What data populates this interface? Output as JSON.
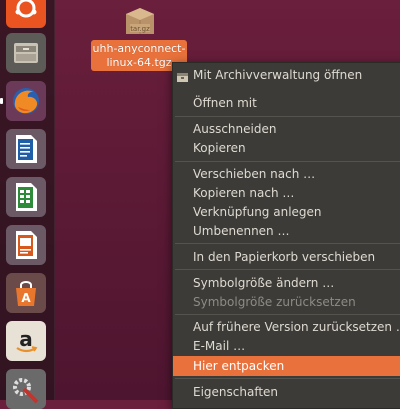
{
  "launcher": {
    "items": [
      {
        "name": "ubuntu-dash-icon"
      },
      {
        "name": "files-icon"
      },
      {
        "name": "firefox-icon"
      },
      {
        "name": "writer-icon"
      },
      {
        "name": "calc-icon"
      },
      {
        "name": "impress-icon"
      },
      {
        "name": "software-center-icon"
      },
      {
        "name": "amazon-icon"
      },
      {
        "name": "system-settings-icon"
      }
    ]
  },
  "desktop_file": {
    "icon_text": "tar.gz",
    "label_line1": "uhh-anyconnect-",
    "label_line2": "linux-64.tgz"
  },
  "menu": {
    "open_with_archiver": "Mit Archivverwaltung öffnen",
    "open_with": "Öffnen mit",
    "cut": "Ausschneiden",
    "copy": "Kopieren",
    "move_to": "Verschieben nach …",
    "copy_to": "Kopieren nach …",
    "make_link": "Verknüpfung anlegen",
    "rename": "Umbenennen …",
    "trash": "In den Papierkorb verschieben",
    "resize_icon": "Symbolgröße ändern …",
    "restore_icon_size": "Symbolgröße zurücksetzen",
    "revert_version": "Auf frühere Version zurücksetzen …",
    "email": "E-Mail …",
    "extract_here": "Hier entpacken",
    "properties": "Eigenschaften"
  },
  "colors": {
    "accent": "#e9723c",
    "menu_bg": "#3c3b37",
    "desktop": "#5a1934"
  }
}
